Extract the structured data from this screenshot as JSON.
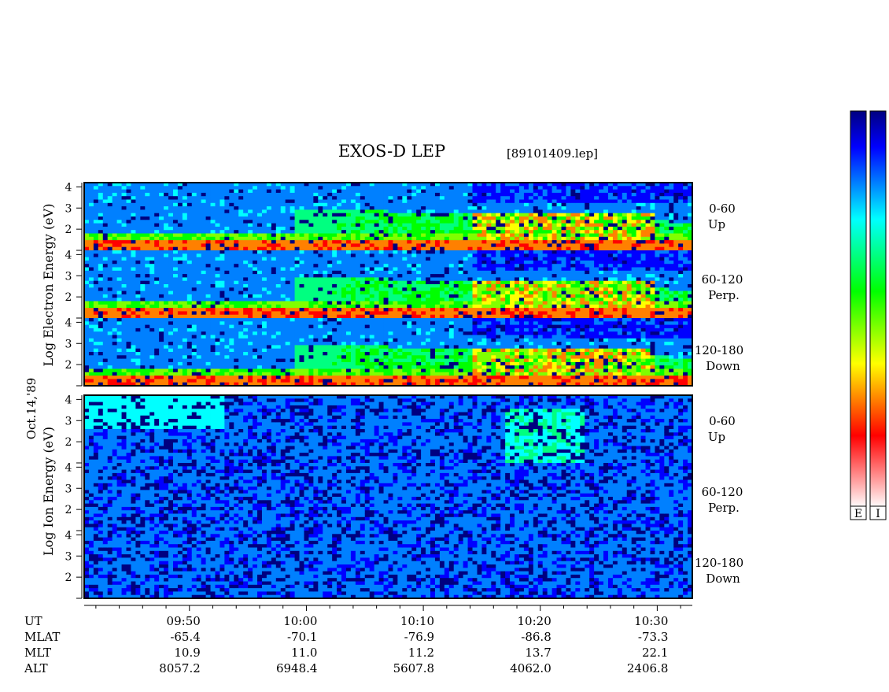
{
  "chart_data": {
    "type": "heatmap",
    "title": "EXOS-D LEP",
    "file_label": "[89101409.lep]",
    "date_label": "Oct.14,'89",
    "electron_ylabel": "Log Electron Energy (eV)",
    "ion_ylabel": "Log Ion Energy (eV)",
    "yticks": [
      2,
      3,
      4
    ],
    "ylim": [
      1,
      4.2
    ],
    "xlim_minutes_utc": [
      "09:41",
      "10:33"
    ],
    "electron_panels": [
      {
        "name_line1": "0-60",
        "name_line2": "Up"
      },
      {
        "name_line1": "60-120",
        "name_line2": "Perp."
      },
      {
        "name_line1": "120-180",
        "name_line2": "Down"
      }
    ],
    "ion_panels": [
      {
        "name_line1": "0-60",
        "name_line2": "Up"
      },
      {
        "name_line1": "60-120",
        "name_line2": "Perp."
      },
      {
        "name_line1": "120-180",
        "name_line2": "Down"
      }
    ],
    "orbit_table": {
      "row_labels": [
        "UT",
        "MLAT",
        "MLT",
        "ALT"
      ],
      "columns": [
        {
          "UT": "09:50",
          "MLAT": "-65.4",
          "MLT": "10.9",
          "ALT": "8057.2"
        },
        {
          "UT": "10:00",
          "MLAT": "-70.1",
          "MLT": "11.0",
          "ALT": "6948.4"
        },
        {
          "UT": "10:10",
          "MLAT": "-76.9",
          "MLT": "11.2",
          "ALT": "5607.8"
        },
        {
          "UT": "10:20",
          "MLAT": "-86.8",
          "MLT": "13.7",
          "ALT": "4062.0"
        },
        {
          "UT": "10:30",
          "MLAT": "-73.3",
          "MLT": "22.1",
          "ALT": "2406.8"
        }
      ]
    },
    "colorbars": [
      {
        "label": "E"
      },
      {
        "label": "I"
      }
    ],
    "colorscale": [
      "#000080",
      "#0000ff",
      "#0080ff",
      "#00ffff",
      "#00ff80",
      "#00ff00",
      "#80ff00",
      "#ffff00",
      "#ff8000",
      "#ff0000",
      "#ff8080",
      "#ffffff"
    ],
    "description_of_features": {
      "electron_low_energy_band_logE": 1.3,
      "electron_band_broadening_start_UT": "09:59",
      "electron_intense_region_UT": [
        "10:14",
        "10:30"
      ],
      "ion_intensification_UT": [
        "10:17",
        "10:24"
      ]
    }
  }
}
